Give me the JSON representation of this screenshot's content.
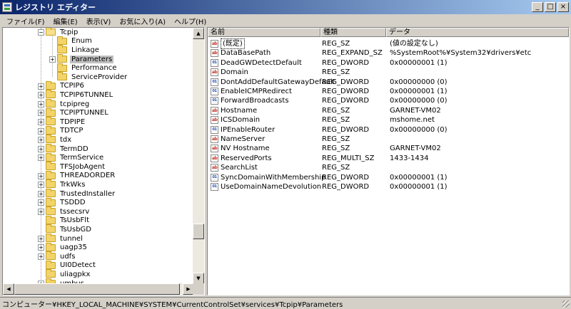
{
  "window": {
    "title": "レジストリ エディター",
    "buttons": {
      "minimize": "_",
      "maximize": "□",
      "close": "×"
    }
  },
  "menu": [
    "ファイル(F)",
    "編集(E)",
    "表示(V)",
    "お気に入り(A)",
    "ヘルプ(H)"
  ],
  "tree": {
    "items": [
      {
        "label": "Tcpip",
        "depth": 0,
        "expander": "−",
        "open": true
      },
      {
        "label": "Enum",
        "depth": 1,
        "expander": ""
      },
      {
        "label": "Linkage",
        "depth": 1,
        "expander": ""
      },
      {
        "label": "Parameters",
        "depth": 1,
        "expander": "+",
        "selected": true
      },
      {
        "label": "Performance",
        "depth": 1,
        "expander": ""
      },
      {
        "label": "ServiceProvider",
        "depth": 1,
        "expander": ""
      },
      {
        "label": "TCPIP6",
        "depth": 0,
        "expander": "+"
      },
      {
        "label": "TCPIP6TUNNEL",
        "depth": 0,
        "expander": "+"
      },
      {
        "label": "tcpipreg",
        "depth": 0,
        "expander": "+"
      },
      {
        "label": "TCPIPTUNNEL",
        "depth": 0,
        "expander": "+"
      },
      {
        "label": "TDPIPE",
        "depth": 0,
        "expander": "+"
      },
      {
        "label": "TDTCP",
        "depth": 0,
        "expander": "+"
      },
      {
        "label": "tdx",
        "depth": 0,
        "expander": "+"
      },
      {
        "label": "TermDD",
        "depth": 0,
        "expander": "+"
      },
      {
        "label": "TermService",
        "depth": 0,
        "expander": "+"
      },
      {
        "label": "TFSJobAgent",
        "depth": 0,
        "expander": ""
      },
      {
        "label": "THREADORDER",
        "depth": 0,
        "expander": "+"
      },
      {
        "label": "TrkWks",
        "depth": 0,
        "expander": "+"
      },
      {
        "label": "TrustedInstaller",
        "depth": 0,
        "expander": "+"
      },
      {
        "label": "TSDDD",
        "depth": 0,
        "expander": "+"
      },
      {
        "label": "tssecsrv",
        "depth": 0,
        "expander": "+"
      },
      {
        "label": "TsUsbFlt",
        "depth": 0,
        "expander": ""
      },
      {
        "label": "TsUsbGD",
        "depth": 0,
        "expander": ""
      },
      {
        "label": "tunnel",
        "depth": 0,
        "expander": "+"
      },
      {
        "label": "uagp35",
        "depth": 0,
        "expander": "+"
      },
      {
        "label": "udfs",
        "depth": 0,
        "expander": "+"
      },
      {
        "label": "UI0Detect",
        "depth": 0,
        "expander": ""
      },
      {
        "label": "uliagpkx",
        "depth": 0,
        "expander": ""
      },
      {
        "label": "umbus",
        "depth": 0,
        "expander": "+"
      }
    ]
  },
  "list": {
    "columns": [
      "名前",
      "種類",
      "データ"
    ],
    "rows": [
      {
        "icon": "ab",
        "name": "(既定)",
        "type": "REG_SZ",
        "data": "(値の設定なし)",
        "default": true
      },
      {
        "icon": "ab",
        "name": "DataBasePath",
        "type": "REG_EXPAND_SZ",
        "data": "%SystemRoot%¥System32¥drivers¥etc"
      },
      {
        "icon": "01",
        "name": "DeadGWDetectDefault",
        "type": "REG_DWORD",
        "data": "0x00000001 (1)"
      },
      {
        "icon": "ab",
        "name": "Domain",
        "type": "REG_SZ",
        "data": ""
      },
      {
        "icon": "01",
        "name": "DontAddDefaultGatewayDefault",
        "type": "REG_DWORD",
        "data": "0x00000000 (0)"
      },
      {
        "icon": "01",
        "name": "EnableICMPRedirect",
        "type": "REG_DWORD",
        "data": "0x00000001 (1)"
      },
      {
        "icon": "01",
        "name": "ForwardBroadcasts",
        "type": "REG_DWORD",
        "data": "0x00000000 (0)"
      },
      {
        "icon": "ab",
        "name": "Hostname",
        "type": "REG_SZ",
        "data": "GARNET-VM02"
      },
      {
        "icon": "ab",
        "name": "ICSDomain",
        "type": "REG_SZ",
        "data": "mshome.net"
      },
      {
        "icon": "01",
        "name": "IPEnableRouter",
        "type": "REG_DWORD",
        "data": "0x00000000 (0)"
      },
      {
        "icon": "ab",
        "name": "NameServer",
        "type": "REG_SZ",
        "data": ""
      },
      {
        "icon": "ab",
        "name": "NV Hostname",
        "type": "REG_SZ",
        "data": "GARNET-VM02"
      },
      {
        "icon": "ab",
        "name": "ReservedPorts",
        "type": "REG_MULTI_SZ",
        "data": "1433-1434"
      },
      {
        "icon": "ab",
        "name": "SearchList",
        "type": "REG_SZ",
        "data": ""
      },
      {
        "icon": "01",
        "name": "SyncDomainWithMembership",
        "type": "REG_DWORD",
        "data": "0x00000001 (1)"
      },
      {
        "icon": "01",
        "name": "UseDomainNameDevolution",
        "type": "REG_DWORD",
        "data": "0x00000001 (1)"
      }
    ]
  },
  "status": {
    "path": "コンピューター¥HKEY_LOCAL_MACHINE¥SYSTEM¥CurrentControlSet¥services¥Tcpip¥Parameters"
  }
}
